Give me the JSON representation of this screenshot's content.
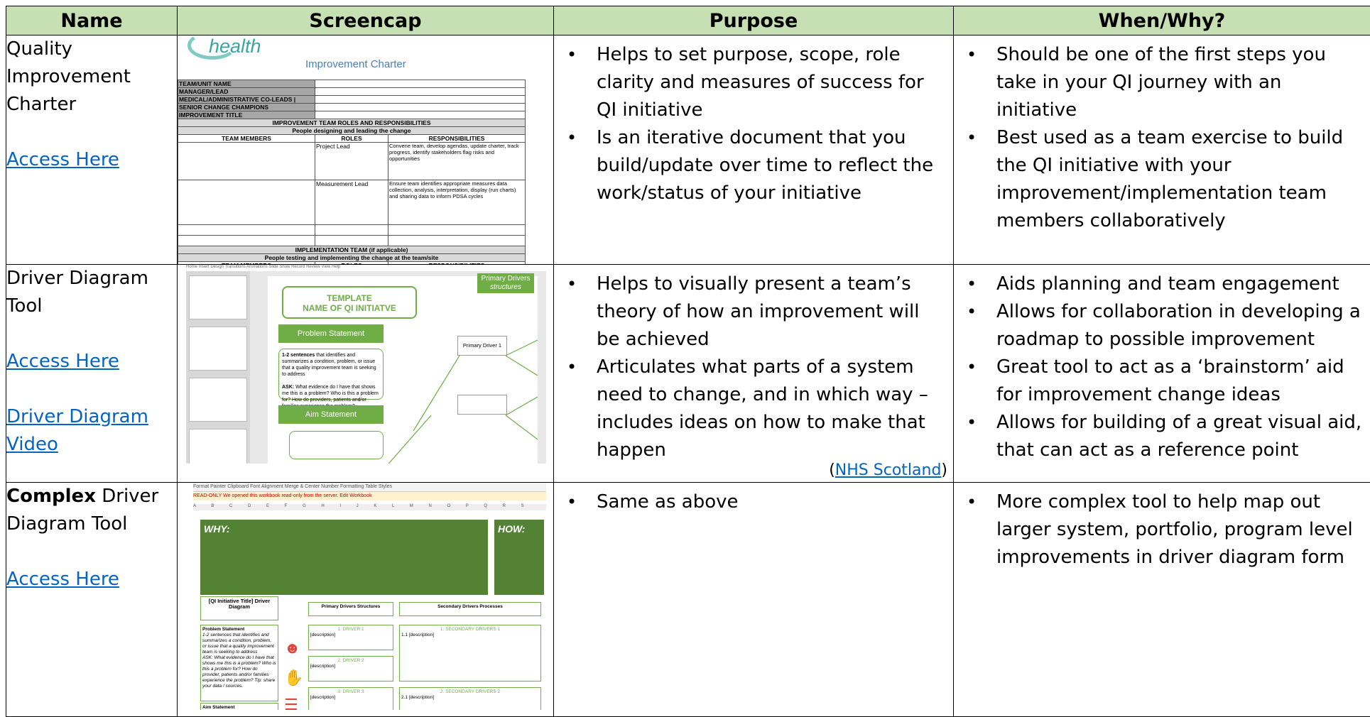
{
  "headers": {
    "name": "Name",
    "screencap": "Screencap",
    "purpose": "Purpose",
    "when_why": "When/Why?"
  },
  "rows": [
    {
      "name_line1": "Quality",
      "name_line2": "Improvement",
      "name_line3": "Charter",
      "links": [
        "Access Here"
      ],
      "purpose": [
        "Helps to set purpose, scope, role clarity and measures of success for QI initiative",
        "Is an iterative document that you build/update over time to reflect the work/status of your initiative"
      ],
      "when": [
        "Should be one of the first steps you take in your QI journey with an initiative",
        "Best used as a team exercise to build the QI initiative with your improvement/implementation team members collaboratively"
      ]
    },
    {
      "name_line1": "Driver Diagram",
      "name_line2": "Tool",
      "links": [
        "Access Here",
        "Driver Diagram",
        "Video"
      ],
      "purpose": [
        "Helps to visually present a team’s theory of how an improvement will be achieved",
        "Articulates what parts of a system need to change, and in which way – includes ideas on how to make that happen"
      ],
      "citation_link": "NHS Scotland",
      "when": [
        "Aids planning and team engagement",
        "Allows for collaboration in developing a roadmap to possible improvement",
        "Great tool to act as a ‘brainstorm’ aid for improvement change ideas",
        "Allows for building of a great visual aid, that can act as a reference point"
      ]
    },
    {
      "name_bold": "Complex",
      "name_rest": " Driver",
      "name_line2": "Diagram Tool",
      "links": [
        "Access Here"
      ],
      "purpose": [
        "Same as above"
      ],
      "when": [
        "More complex tool to help map out larger system, portfolio, program level improvements in driver diagram form"
      ]
    }
  ],
  "charter_shot": {
    "logo": "health",
    "title": "Improvement Charter",
    "fields": [
      "TEAM/UNIT NAME",
      "MANAGER/LEAD",
      "MEDICAL/ADMINISTRATIVE CO-LEADS |",
      "SENIOR CHANGE CHAMPIONS",
      "IMPROVEMENT TITLE"
    ],
    "roles_header": "IMPROVEMENT TEAM ROLES AND RESPONSIBILITIES",
    "roles_sub": "People designing and leading the change",
    "cols": [
      "TEAM MEMBERS",
      "ROLES",
      "RESPONSIBILITIES"
    ],
    "role1": "Project Lead",
    "role1_text": "Convene team, develop agendas, update charter, track progress, identify stakeholders flag risks and opportunities",
    "role2": "Measurement Lead",
    "role2_text": "Ensure team identifies appropriate measures data collection, analysis, interpretation, display (run charts) and sharing data to inform PDSA cycles",
    "impl_header": "IMPLEMENTATION TEAM (if applicable)",
    "impl_sub": "People testing and implementing the change at the team/site"
  },
  "driver_shot": {
    "ribbon": "Home   Insert   Design   Transitions   Animations   Slide Show   Record   Review   View   Help",
    "template_line1": "TEMPLATE",
    "template_line2": "NAME OF QI INITIATVE",
    "problem": "Problem Statement",
    "problem_text_bold": "1-2 sentences",
    "problem_text": " that identifies and summarizes a condition, problem, or issue that a quality improvement team is seeking to address",
    "ask_bold": "ASK:",
    "ask_text": " What evidence do I have that shows me this is a problem? Who is this a problem for? How do providers, patients and/or families experience the problem?",
    "aim": "Aim Statement",
    "primary": "Primary Drivers",
    "primary_sub": "structures",
    "pd1": "Primary Driver 1"
  },
  "complex_shot": {
    "toolbar": "Format Painter   Clipboard   Font   Alignment   Merge & Center   Number   Formatting   Table   Styles",
    "readonly": "READ-ONLY   We opened this workbook read-only from the server.   Edit Workbook",
    "columns": "A B C D E F G H I J K L M N O P Q R S",
    "why": "WHY:",
    "how": "HOW:",
    "title_box": "[QI Initiative Title] Driver Diagram",
    "primary_box": "Primary Drivers Structures",
    "secondary_box": "Secondary Drivers Processes",
    "driver1": "1. DRIVER 1",
    "driver2": "2. DRIVER 2",
    "driver3": "3. DRIVER 3",
    "sec1": "1. SECONDARY DRIVERS 1",
    "sec2": "2. SECONDARY DRIVERS 2",
    "desc": "[description]",
    "sec_desc1": "1.1 [description]",
    "sec_desc2": "2.1 [description]",
    "problem": "Problem Statement",
    "problem_text": "1-2 sentences that identifies and summarizes a condition, problem, or issue that a quality improvement team is seeking to address",
    "ask_text": "ASK: What evidence do I have that shows me this is a problem? Who is this a problem for? How do provider, patients and/or families experience the problem? Tip: share your data / sources.",
    "aim": "Aim Statement"
  }
}
